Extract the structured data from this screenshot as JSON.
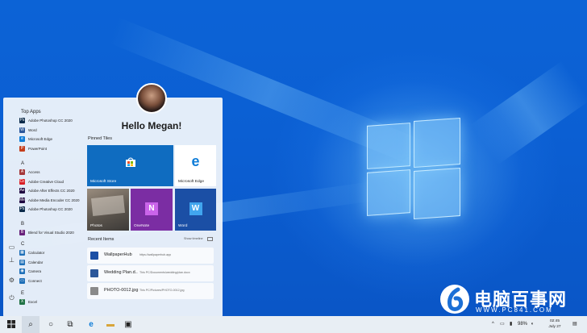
{
  "greeting": "Hello Megan!",
  "app_list": {
    "top_apps_header": "Top Apps",
    "top_apps": [
      {
        "label": "Adobe Photoshop CC 2020",
        "icon": "photoshop-icon",
        "color": "#0b2a4a"
      },
      {
        "label": "Word",
        "icon": "word-icon",
        "color": "#2b579a"
      },
      {
        "label": "Microsoft Edge",
        "icon": "edge-icon",
        "color": "#0f7dd8"
      },
      {
        "label": "PowerPoint",
        "icon": "powerpoint-icon",
        "color": "#c43e1c"
      }
    ],
    "section_a": "A",
    "a_apps": [
      {
        "label": "Access",
        "icon": "access-icon",
        "color": "#a4373a"
      },
      {
        "label": "Adobe Creative Cloud",
        "icon": "creative-cloud-icon",
        "color": "#da1f26"
      },
      {
        "label": "Adobe After Effects CC 2020",
        "icon": "after-effects-icon",
        "color": "#1f0740"
      },
      {
        "label": "Adobe Media Encoder CC 2020",
        "icon": "media-encoder-icon",
        "color": "#1f0740"
      },
      {
        "label": "Adobe Photoshop CC 2020",
        "icon": "photoshop-icon",
        "color": "#0b2a4a"
      }
    ],
    "section_b": "B",
    "b_apps": [
      {
        "label": "Blend for Visual Studio 2020",
        "icon": "blend-icon",
        "color": "#68217a"
      }
    ],
    "section_c": "C",
    "c_apps": [
      {
        "label": "Calculator",
        "icon": "calculator-icon",
        "color": "#1e6fb8"
      },
      {
        "label": "Calendar",
        "icon": "calendar-icon",
        "color": "#1e6fb8"
      },
      {
        "label": "Camera",
        "icon": "camera-icon",
        "color": "#1e6fb8"
      },
      {
        "label": "Connect",
        "icon": "connect-icon",
        "color": "#1e6fb8"
      }
    ],
    "section_e": "E",
    "e_apps": [
      {
        "label": "Excel",
        "icon": "excel-icon",
        "color": "#217346"
      }
    ]
  },
  "pinned": {
    "header": "Pinned Tiles",
    "tiles": {
      "store": {
        "label": "Microsoft Store",
        "icon": "store-icon"
      },
      "edge": {
        "label": "Microsoft Edge",
        "icon": "edge-icon"
      },
      "photos": {
        "label": "Photos",
        "icon": "photos-icon"
      },
      "onenote": {
        "label": "OneNote",
        "icon": "onenote-icon"
      },
      "word": {
        "label": "Word",
        "icon": "word-icon"
      }
    }
  },
  "recent": {
    "header": "Recent Items",
    "show_more": "Show timeline",
    "items": [
      {
        "name": "WallpaperHub",
        "path": "https://wallpaperhub.app",
        "icon": "wallpaperhub-icon"
      },
      {
        "name": "Wedding Plan.d..",
        "path": "This PC/Documents/wedding/plan.docx",
        "icon": "word-doc-icon"
      },
      {
        "name": "PHOTO-0012.jpg",
        "path": "This PC/Pictures/PHOTO-0012.jpg",
        "icon": "image-file-icon"
      }
    ]
  },
  "taskbar": {
    "battery": "98%",
    "clock_time": "02:45",
    "clock_date": "July 27"
  },
  "watermark": {
    "text": "电脑百事网",
    "url": "WWW.PC841.COM"
  }
}
